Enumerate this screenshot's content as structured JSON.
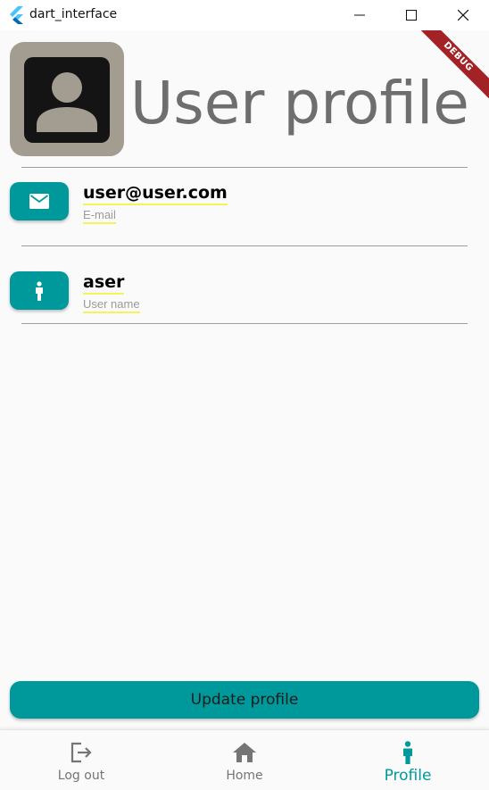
{
  "window": {
    "title": "dart_interface",
    "icon": "flutter-logo-icon"
  },
  "debug_banner": "DEBUG",
  "header": {
    "title": "User profile",
    "avatar_icon": "account-box-icon"
  },
  "fields": [
    {
      "icon": "mail-icon",
      "value": "user@user.com",
      "label": "E-mail"
    },
    {
      "icon": "person-icon",
      "value": "aser",
      "label": "User name"
    }
  ],
  "actions": {
    "update_label": "Update profile"
  },
  "nav": {
    "items": [
      {
        "icon": "logout-icon",
        "label": "Log out"
      },
      {
        "icon": "home-icon",
        "label": "Home"
      },
      {
        "icon": "person-icon",
        "label": "Profile"
      }
    ],
    "active_index": 2
  },
  "colors": {
    "accent": "#00999b",
    "avatar_bg": "#a39d91",
    "title_text": "#6e6e6e",
    "ribbon": "#a32226",
    "label_underline": "#f4f35a"
  }
}
